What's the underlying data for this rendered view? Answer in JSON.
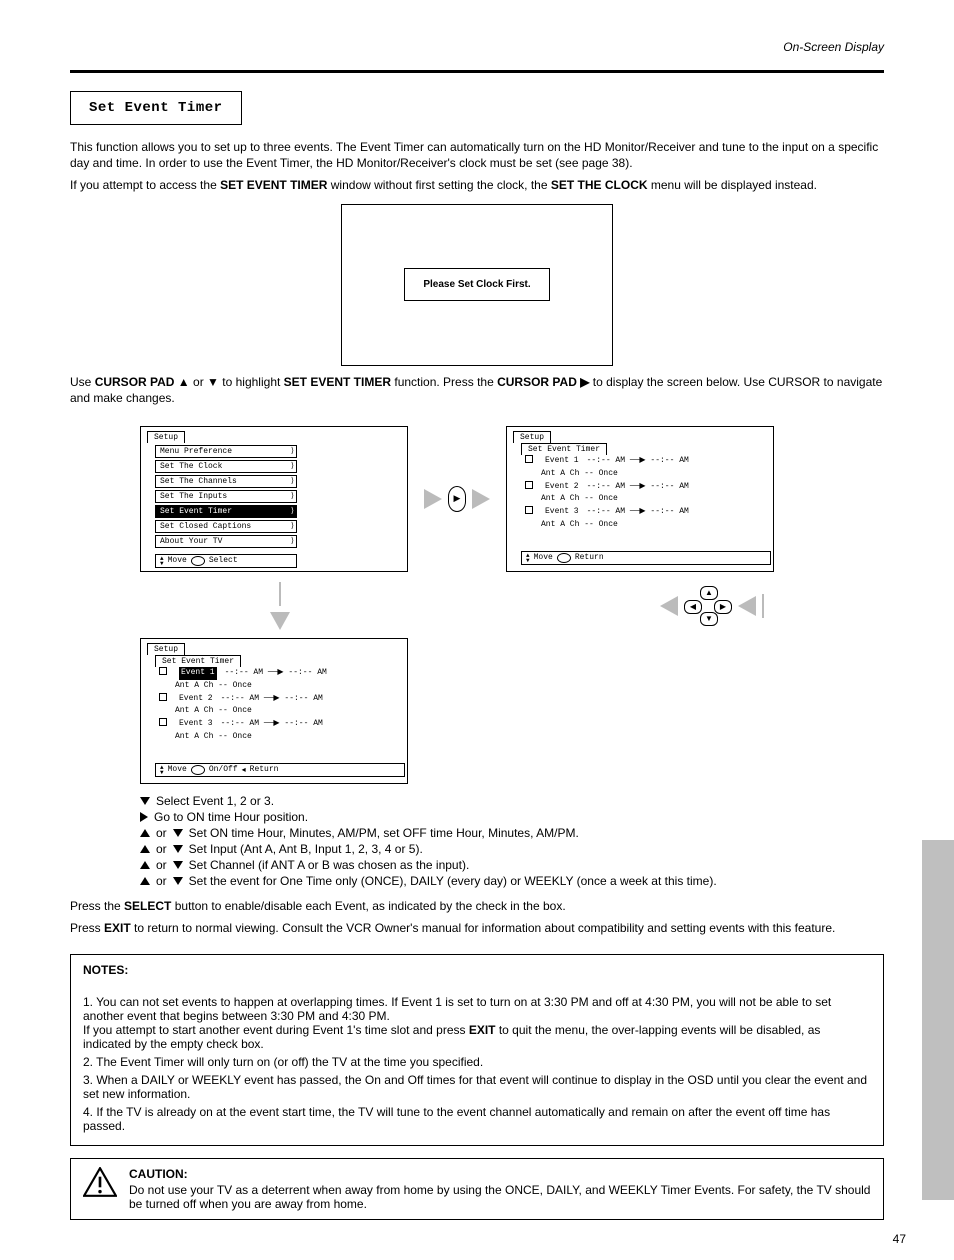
{
  "header": {
    "section_title": "On-Screen Display",
    "box_title": "Set Event Timer"
  },
  "intro": {
    "p1": "This function allows you to set up to three events. The Event Timer can automatically turn on the HD Monitor/Receiver and tune to the input on a specific day and time. In order to use the Event Timer, the HD Monitor/Receiver's clock must be set (see page 38).",
    "p2_prefix": "If you attempt to access the ",
    "p2_bold1": "SET EVENT TIMER",
    "p2_mid": " window without first setting the clock, the ",
    "p2_bold2": "SET THE CLOCK",
    "p2_suffix": " menu will be displayed instead."
  },
  "dialog": {
    "text": "Please Set Clock First."
  },
  "steps": {
    "p3_prefix": "Use ",
    "p3_b1": "CURSOR PAD ▲",
    "p3_or1": " or ",
    "p3_b2": "▼",
    "p3_mid1": " to highlight ",
    "p3_b3": "SET EVENT TIMER",
    "p3_mid2": " function. Press the ",
    "p3_b4": "CURSOR PAD ▶",
    "p3_suffix": " to display the screen below. Use CURSOR to navigate and make changes.",
    "legend": [
      {
        "icon": "down",
        "text": "Select Event 1, 2 or 3."
      },
      {
        "icon": "right",
        "text": "Go to ON time Hour position."
      },
      {
        "icons": [
          "up",
          "down"
        ],
        "text": "Set ON time Hour, Minutes, AM/PM, set OFF time Hour, Minutes, AM/PM."
      },
      {
        "icons": [
          "up",
          "down"
        ],
        "text": "Set Input (Ant A, Ant B, Input 1, 2, 3, 4 or 5)."
      },
      {
        "icons": [
          "up",
          "down"
        ],
        "text": "Set Channel (if ANT A or B was chosen as the input)."
      },
      {
        "icons": [
          "up",
          "down"
        ],
        "text": "Set the event for One Time only (ONCE), DAILY (every day) or WEEKLY (once a week at this time)."
      }
    ],
    "p4_1": "Press the ",
    "p4_b1": "SELECT",
    "p4_2": " button to enable/disable each Event, as indicated by the check in the box.",
    "p5_1": "Press ",
    "p5_b1": "EXIT",
    "p5_2": " to return to normal viewing. Consult the VCR Owner's manual for information about compatibility and setting events with this feature."
  },
  "osd1": {
    "tab": "Setup",
    "items": [
      "Menu Preference",
      "Set The Clock",
      "Set The Channels",
      "Set The Inputs",
      "Set Event Timer",
      "Set Closed Captions",
      "About Your TV"
    ],
    "highlight_index": 4,
    "foot_move": "Move",
    "foot_select": "Select"
  },
  "osd2": {
    "tab": "Setup",
    "subtab": "Set Event Timer",
    "events": [
      {
        "label": "Event 1",
        "time": "--:-- AM → --:-- AM",
        "line2": "Ant A    Ch --    Once"
      },
      {
        "label": "Event 2",
        "time": "--:-- AM → --:-- AM",
        "line2": "Ant A    Ch --    Once"
      },
      {
        "label": "Event 3",
        "time": "--:-- AM → --:-- AM",
        "line2": "Ant A    Ch --    Once"
      }
    ],
    "foot_move": "Move",
    "foot_return": "Return"
  },
  "osd3": {
    "tab": "Setup",
    "subtab": "Set Event Timer",
    "foot_move": "Move",
    "foot_onoff": "On/Off",
    "foot_return": "Return"
  },
  "notes": {
    "title": "NOTES:",
    "n1_pre": "1. You can not set events to happen at overlapping times. If Event 1 is set to turn on at 3:30 PM and off at 4:30 PM, you will not be able to set another event that begins between 3:30 PM and 4:30 PM.\nIf you attempt to start another event during Event 1's time slot and press ",
    "n1_b": "EXIT",
    "n1_post": " to quit the menu, the over-lapping events will be disabled, as indicated by the empty check box.",
    "n2": "2. The Event Timer will only turn on (or off) the TV at the time you specified.",
    "n3": "3. When a DAILY or WEEKLY event has passed, the On and Off times for that event will continue to display in the OSD until you clear the event and set new information.",
    "n4": "4. If the TV is already on at the event start time, the TV will tune to the event channel automatically and remain on after the event off time has passed."
  },
  "caution": {
    "title": "CAUTION:",
    "body": "Do not use your TV as a deterrent when away from home by using the ONCE, DAILY, and WEEKLY Timer Events. For safety, the TV should be turned off when you are away from home."
  },
  "page_number": "47"
}
